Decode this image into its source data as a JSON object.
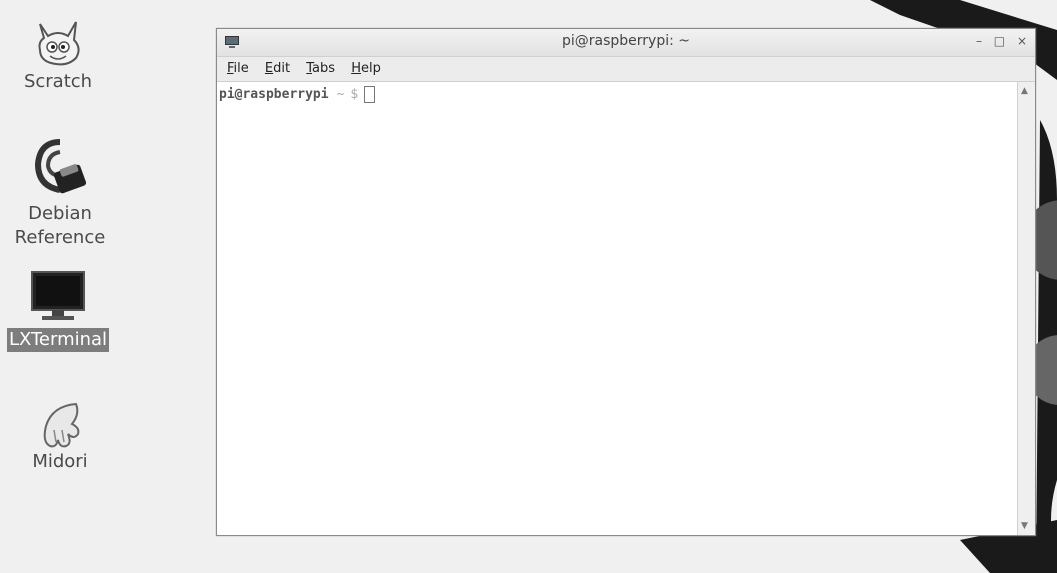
{
  "desktop": {
    "icons": [
      {
        "label": "Scratch",
        "icon": "scratch-cat-icon"
      },
      {
        "label": "Debian\nReference",
        "icon": "debian-reference-icon"
      },
      {
        "label": "LXTerminal",
        "icon": "monitor-icon",
        "selected": true
      },
      {
        "label": "Midori",
        "icon": "midori-icon"
      }
    ]
  },
  "window": {
    "title": "pi@raspberrypi: ~",
    "controls": [
      "minimize",
      "maximize",
      "close"
    ],
    "menu": [
      {
        "label": "File",
        "accesskey": "F"
      },
      {
        "label": "Edit",
        "accesskey": "E"
      },
      {
        "label": "Tabs",
        "accesskey": "T"
      },
      {
        "label": "Help",
        "accesskey": "H"
      }
    ],
    "prompt": {
      "user": "pi@raspberrypi",
      "path": "~",
      "symbol": "$"
    }
  },
  "colors": {
    "desktop_bg": "#f0f0f0",
    "selected_label_bg": "#7d7d7d",
    "wallpaper_dark": "#1a1a1a"
  }
}
